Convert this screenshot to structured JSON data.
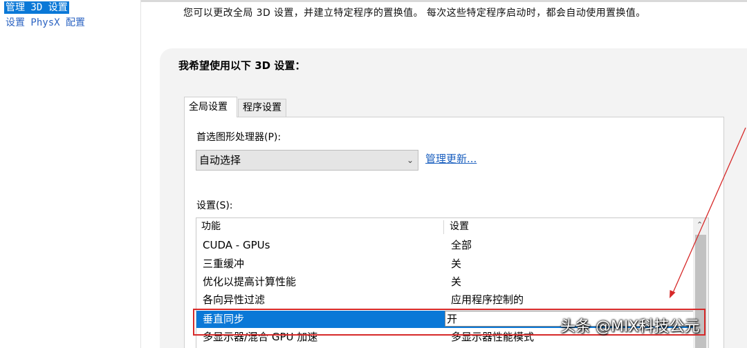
{
  "nav": {
    "items": [
      {
        "label": "管理 3D 设置",
        "selected": true
      },
      {
        "label": "设置 PhysX 配置",
        "selected": false
      }
    ]
  },
  "main": {
    "intro": "您可以更改全局 3D 设置，并建立特定程序的置换值。 每次这些特定程序启动时，都会自动使用置换值。",
    "section_title": "我希望使用以下 3D 设置：",
    "tabs": [
      {
        "label": "全局设置",
        "active": true
      },
      {
        "label": "程序设置",
        "active": false
      }
    ],
    "processor": {
      "label": "首选图形处理器(P):",
      "value": "自动选择",
      "update_link": "管理更新..."
    },
    "settings": {
      "label": "设置(S):",
      "columns": [
        "功能",
        "设置"
      ],
      "rows": [
        {
          "feature": "CUDA - GPUs",
          "value": "全部"
        },
        {
          "feature": "三重缓冲",
          "value": "关"
        },
        {
          "feature": "优化以提高计算性能",
          "value": "关"
        },
        {
          "feature": "各向异性过滤",
          "value": "应用程序控制的"
        },
        {
          "feature": "垂直同步",
          "value": "开",
          "selected": true
        },
        {
          "feature": "多显示器/混合 GPU 加速",
          "value": "多显示器性能模式"
        }
      ]
    }
  },
  "annotation": {
    "color": "#d62828"
  },
  "watermark": "头条 @MIX科技公元",
  "colors": {
    "accent": "#0a78d7",
    "link": "#1a5fbf",
    "highlight": "#d62828"
  },
  "icons": {
    "select_arrow": "chevron-down-icon",
    "scroll_up": "chevron-up-icon"
  }
}
